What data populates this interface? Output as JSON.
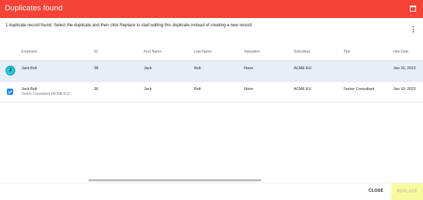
{
  "dialog": {
    "title": "Duplicates found",
    "message": "1 duplicate record found. Select the duplicate and then click Replace to start editing this duplicate instead of creating a new record."
  },
  "table": {
    "columns": [
      "Employee",
      "ID",
      "First Name",
      "Last Name",
      "Salutation",
      "Subsidiary",
      "Title",
      "Hire Date"
    ],
    "rows": [
      {
        "avatar_letter": "J",
        "employee": "Jack Bolt",
        "employee_sub": "",
        "id": "38",
        "first_name": "Jack",
        "last_name": "Bolt",
        "salutation": "None",
        "subsidiary": "ACME EU",
        "title": "",
        "hire_date": "Jan 10, 2023",
        "selected": true
      },
      {
        "avatar_letter": "",
        "employee": "Jack Bolt",
        "employee_sub": "Senior Consultant (ACME EU)",
        "id": "36",
        "first_name": "Jack",
        "last_name": "Bolt",
        "salutation": "None",
        "subsidiary": "ACME EU",
        "title": "Senior Consultant",
        "hire_date": "Jan 10, 2023",
        "checked": true
      }
    ]
  },
  "footer": {
    "close_label": "CLOSE",
    "replace_label": "REPLACE"
  },
  "icons": {
    "maximize": "maximize-icon",
    "more": "more-vert-icon",
    "check": "checkbox-checked-icon"
  },
  "colors": {
    "header": "#f44336",
    "avatar": "#26c6da",
    "checkbox": "#1e88e5",
    "selected_row": "#e8eef8",
    "replace_button": "#f9fba0"
  }
}
